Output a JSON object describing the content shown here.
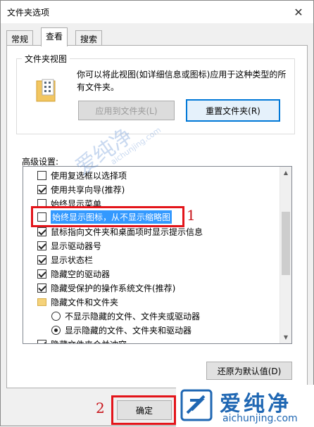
{
  "window": {
    "title": "文件夹选项"
  },
  "tabs": [
    {
      "label": "常规"
    },
    {
      "label": "查看"
    },
    {
      "label": "搜索"
    }
  ],
  "folder_views": {
    "legend": "文件夹视图",
    "description": "你可以将此视图(如详细信息或图标)应用于这种类型的所有文件夹。",
    "apply_button": "应用到文件夹(L)",
    "reset_button": "重置文件夹(R)"
  },
  "advanced": {
    "label": "高级设置:",
    "items": [
      {
        "label": "使用复选框以选择项",
        "checked": false,
        "type": "checkbox"
      },
      {
        "label": "使用共享向导(推荐)",
        "checked": true,
        "type": "checkbox"
      },
      {
        "label": "始终显示菜单",
        "checked": false,
        "type": "checkbox"
      },
      {
        "label": "始终显示图标，从不显示缩略图",
        "checked": false,
        "type": "checkbox"
      },
      {
        "label": "鼠标指向文件夹和桌面项时显示提示信息",
        "checked": true,
        "type": "checkbox"
      },
      {
        "label": "显示驱动器号",
        "checked": true,
        "type": "checkbox"
      },
      {
        "label": "显示状态栏",
        "checked": true,
        "type": "checkbox"
      },
      {
        "label": "隐藏空的驱动器",
        "checked": true,
        "type": "checkbox"
      },
      {
        "label": "隐藏受保护的操作系统文件(推荐)",
        "checked": true,
        "type": "checkbox"
      },
      {
        "label": "隐藏文件和文件夹",
        "type": "folder"
      },
      {
        "label": "不显示隐藏的文件、文件夹或驱动器",
        "checked": false,
        "type": "radio"
      },
      {
        "label": "显示隐藏的文件、文件夹和驱动器",
        "checked": true,
        "type": "radio"
      },
      {
        "label": "隐藏文件夹合并冲突",
        "checked": true,
        "type": "checkbox"
      }
    ],
    "restore_button": "还原为默认值(D)"
  },
  "footer": {
    "ok_button": "确定"
  },
  "annotations": {
    "step1": "1",
    "step2": "2"
  },
  "watermark": {
    "text": "爱纯净",
    "url": "aichunjing.com"
  },
  "logo": {
    "title": "爱纯净",
    "url": "aichunjing.com"
  },
  "colors": {
    "accent": "#0078d7",
    "highlight": "#e3141a",
    "selection": "#3399ff",
    "logo": "#1f67b3"
  }
}
